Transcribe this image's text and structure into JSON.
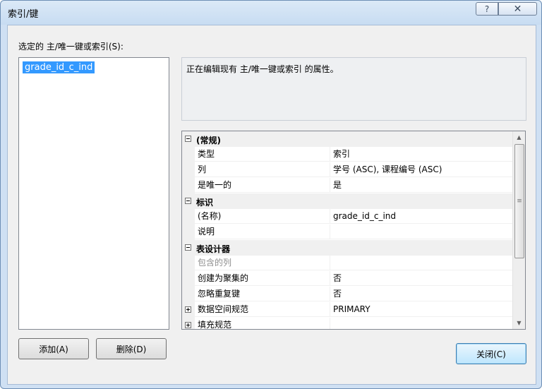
{
  "window": {
    "title": "索引/键",
    "help_label": "?",
    "close_label": "✕"
  },
  "selection_label": "选定的 主/唯一键或索引(S):",
  "list_items": [
    "grade_id_c_ind"
  ],
  "description": "正在编辑现有 主/唯一键或索引 的属性。",
  "grid": {
    "categories": [
      {
        "label": "(常规)",
        "expanded": true,
        "properties": [
          {
            "name": "类型",
            "value": "索引"
          },
          {
            "name": "列",
            "value": "学号 (ASC), 课程编号 (ASC)"
          },
          {
            "name": "是唯一的",
            "value": "是"
          }
        ]
      },
      {
        "label": "标识",
        "expanded": true,
        "properties": [
          {
            "name": "(名称)",
            "value": "grade_id_c_ind"
          },
          {
            "name": "说明",
            "value": ""
          }
        ]
      },
      {
        "label": "表设计器",
        "expanded": true,
        "properties": [
          {
            "name": "包含的列",
            "value": ""
          },
          {
            "name": "创建为聚集的",
            "value": "否"
          },
          {
            "name": "忽略重复键",
            "value": "否"
          },
          {
            "name": "数据空间规范",
            "value": "PRIMARY"
          },
          {
            "name": "填充规范",
            "value": ""
          }
        ]
      }
    ],
    "scrollbar": {
      "up": "▲",
      "down": "▼",
      "grip": "≡"
    }
  },
  "buttons": {
    "add": "添加(A)",
    "delete": "删除(D)",
    "close": "关闭(C)"
  }
}
